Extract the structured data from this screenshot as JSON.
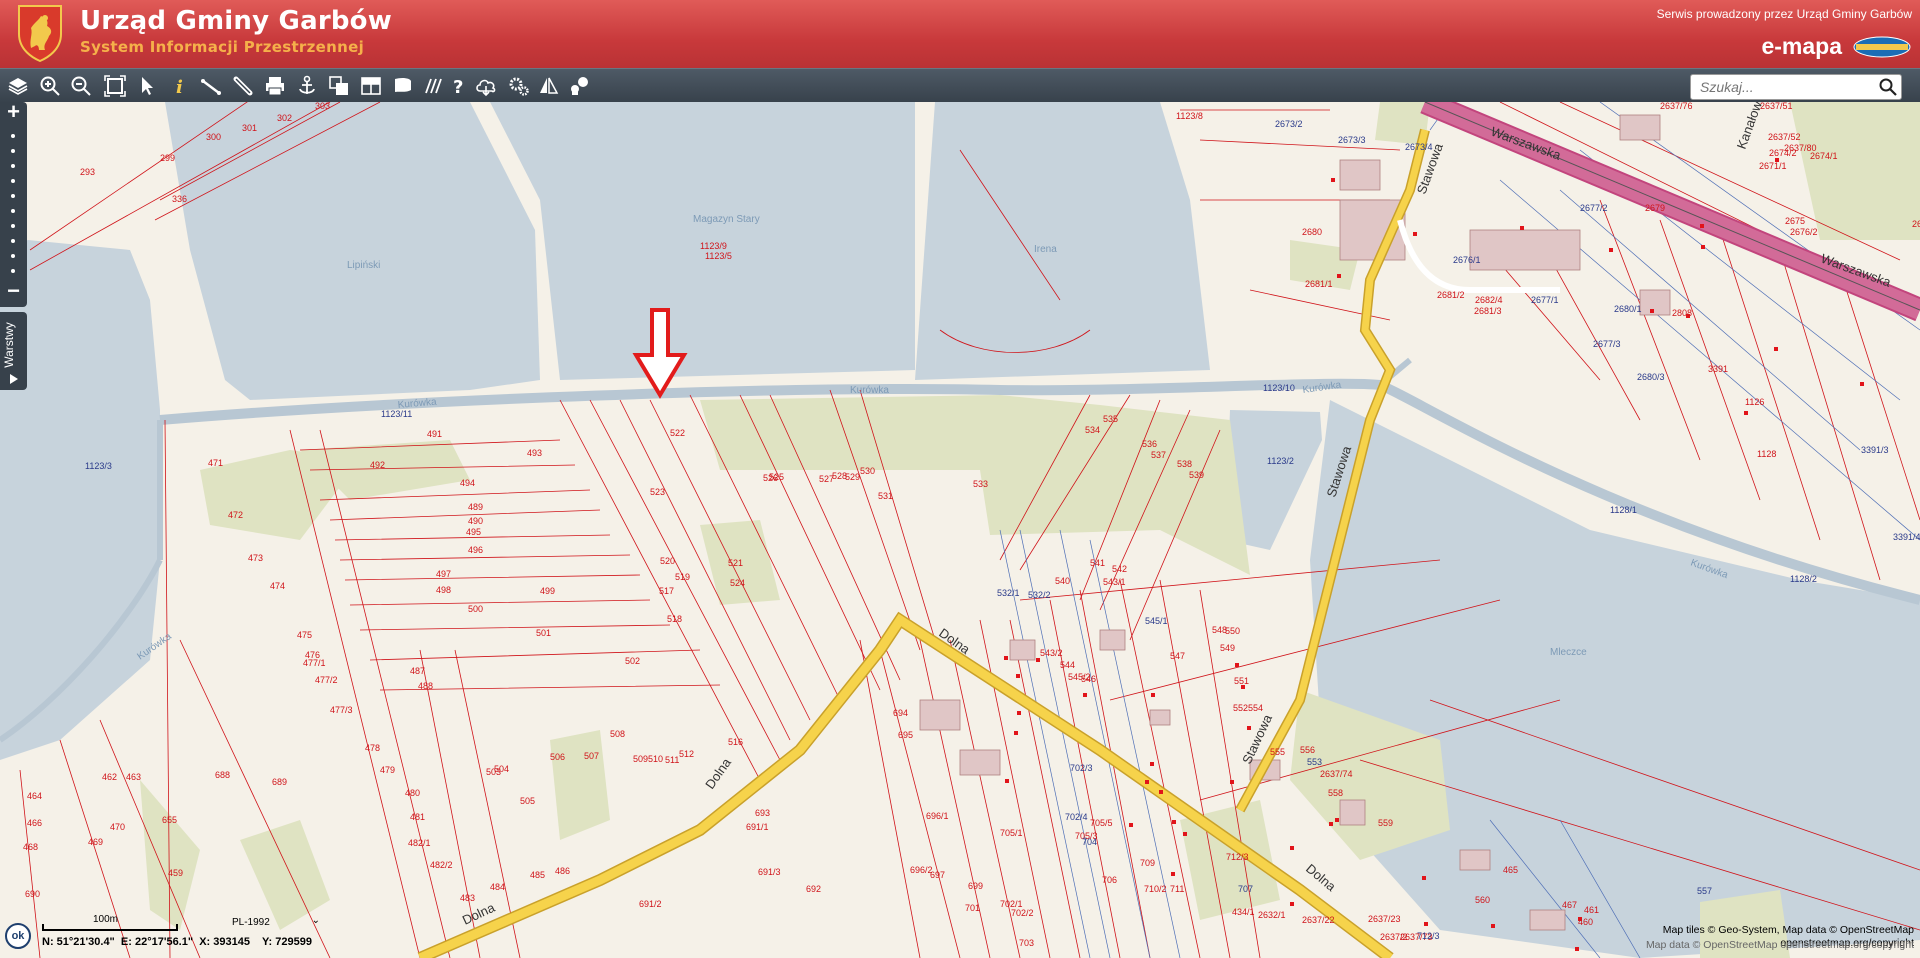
{
  "header": {
    "title": "Urząd Gminy Garbów",
    "subtitle": "System Informacji Przestrzennej",
    "served_by": "Serwis prowadzony przez Urząd Gminy Garbów",
    "brand": "e-mapa"
  },
  "search": {
    "placeholder": "Szukaj..."
  },
  "toolbar": {
    "tools": [
      "layers-icon",
      "zoom-in-icon",
      "zoom-out-icon",
      "full-extent-icon",
      "pointer-icon",
      "info-icon",
      "measure-distance-icon",
      "link-icon",
      "print-icon",
      "anchor-icon",
      "select-area-icon",
      "table-icon",
      "window-icon",
      "polygon-icon",
      "hatch-icon",
      "help-icon",
      "cloud-icon",
      "settings-icon",
      "markers-icon",
      "comment-icon"
    ]
  },
  "side": {
    "layers_label": "Warstwy",
    "zoom_in": "+",
    "zoom_out": "−"
  },
  "footer": {
    "ok": "ok",
    "scale": "100m",
    "crs": "PL-1992",
    "lat": "N: 51°21'30.4\"",
    "lon": "E: 22°17'56.1\"",
    "x": "X: 393145",
    "y": "Y: 729599",
    "attribution_1": "Map tiles © Geo-System, Map data © OpenStreetMap",
    "attribution_2": "openstreetmap.org/copyright",
    "osm": "Map data © OpenStreetMap openstreetmap.org/copyright"
  },
  "colors": {
    "header": "#c8393b",
    "toolbar": "#37414b",
    "water": "#c7d3dc",
    "land": "#f5f1e8",
    "green": "#dfe3c2",
    "road": "#f6d34b",
    "main_road": "#c2457d",
    "parcel": "#d0141a",
    "building": "#e0c6c6",
    "marker": "#e1141a"
  },
  "map": {
    "water_labels": [
      "Lipiński",
      "Magazyn Stary",
      "Irena",
      "Kurówka",
      "Kurówka",
      "Kurówka",
      "Kurówka",
      "Kurówka",
      "Mleczce"
    ],
    "streets": [
      "Warszawska",
      "Warszawska",
      "Stawowa",
      "Stawowa",
      "Stawowa",
      "Dolna",
      "Dolna",
      "Dolna",
      "Dolna",
      "Kanałowa"
    ],
    "red_parcels": [
      "303",
      "301",
      "302",
      "300",
      "299",
      "293",
      "336",
      "1123/8",
      "1123/9",
      "1123/5",
      "491",
      "492",
      "493",
      "494",
      "471",
      "472",
      "473",
      "474",
      "475",
      "476",
      "477/1",
      "477/2",
      "477/3",
      "478",
      "479",
      "480",
      "481",
      "482/1",
      "482/2",
      "483",
      "484",
      "485",
      "486",
      "487",
      "488",
      "489",
      "490",
      "495",
      "496",
      "497",
      "498",
      "499",
      "500",
      "501",
      "502",
      "503",
      "504",
      "505",
      "506",
      "507",
      "508",
      "509",
      "510",
      "511",
      "512",
      "516",
      "517",
      "518",
      "519",
      "520",
      "521",
      "522",
      "523",
      "524",
      "525",
      "526",
      "527",
      "528",
      "529",
      "530",
      "531",
      "533",
      "534",
      "535",
      "536",
      "537",
      "538",
      "539",
      "540",
      "541",
      "542",
      "543/1",
      "543/2",
      "544",
      "545/2",
      "546",
      "547",
      "548",
      "549",
      "550",
      "551",
      "552",
      "554",
      "555",
      "556",
      "558",
      "559",
      "560",
      "465",
      "467",
      "461",
      "460",
      "462",
      "463",
      "464",
      "466",
      "468",
      "469",
      "470",
      "459",
      "655",
      "688",
      "689",
      "690",
      "691/1",
      "691/2",
      "691/3",
      "692",
      "693",
      "694",
      "695",
      "696/1",
      "696/2",
      "697",
      "699",
      "701",
      "702/1",
      "702/2",
      "703",
      "705/1",
      "705/3",
      "705/5",
      "706",
      "709",
      "710/2",
      "711",
      "712/3",
      "434/1",
      "2632/1",
      "2637/22",
      "2637/23",
      "2637/2",
      "2637/73",
      "2637/74",
      "2637/76",
      "2637/51",
      "2637/52",
      "2637/80",
      "2671/1",
      "2674/2",
      "2674/1",
      "2675",
      "2676/2",
      "2678",
      "2679",
      "2680",
      "2681/1",
      "2681/2",
      "2681/3",
      "2682/4",
      "2808",
      "3391",
      "1126",
      "1128"
    ],
    "blue_parcels": [
      "2673/2",
      "2673/3",
      "2673/4",
      "2676/1",
      "2677/1",
      "2677/2",
      "2677/3",
      "2680/1",
      "2680/3",
      "3391/3",
      "3391/4",
      "1128/1",
      "1128/2",
      "1123/10",
      "1123/11",
      "1123/3",
      "1123/2",
      "532/1",
      "532/2",
      "545/1",
      "553",
      "557",
      "702/3",
      "702/4",
      "704",
      "707",
      "712/3"
    ]
  }
}
